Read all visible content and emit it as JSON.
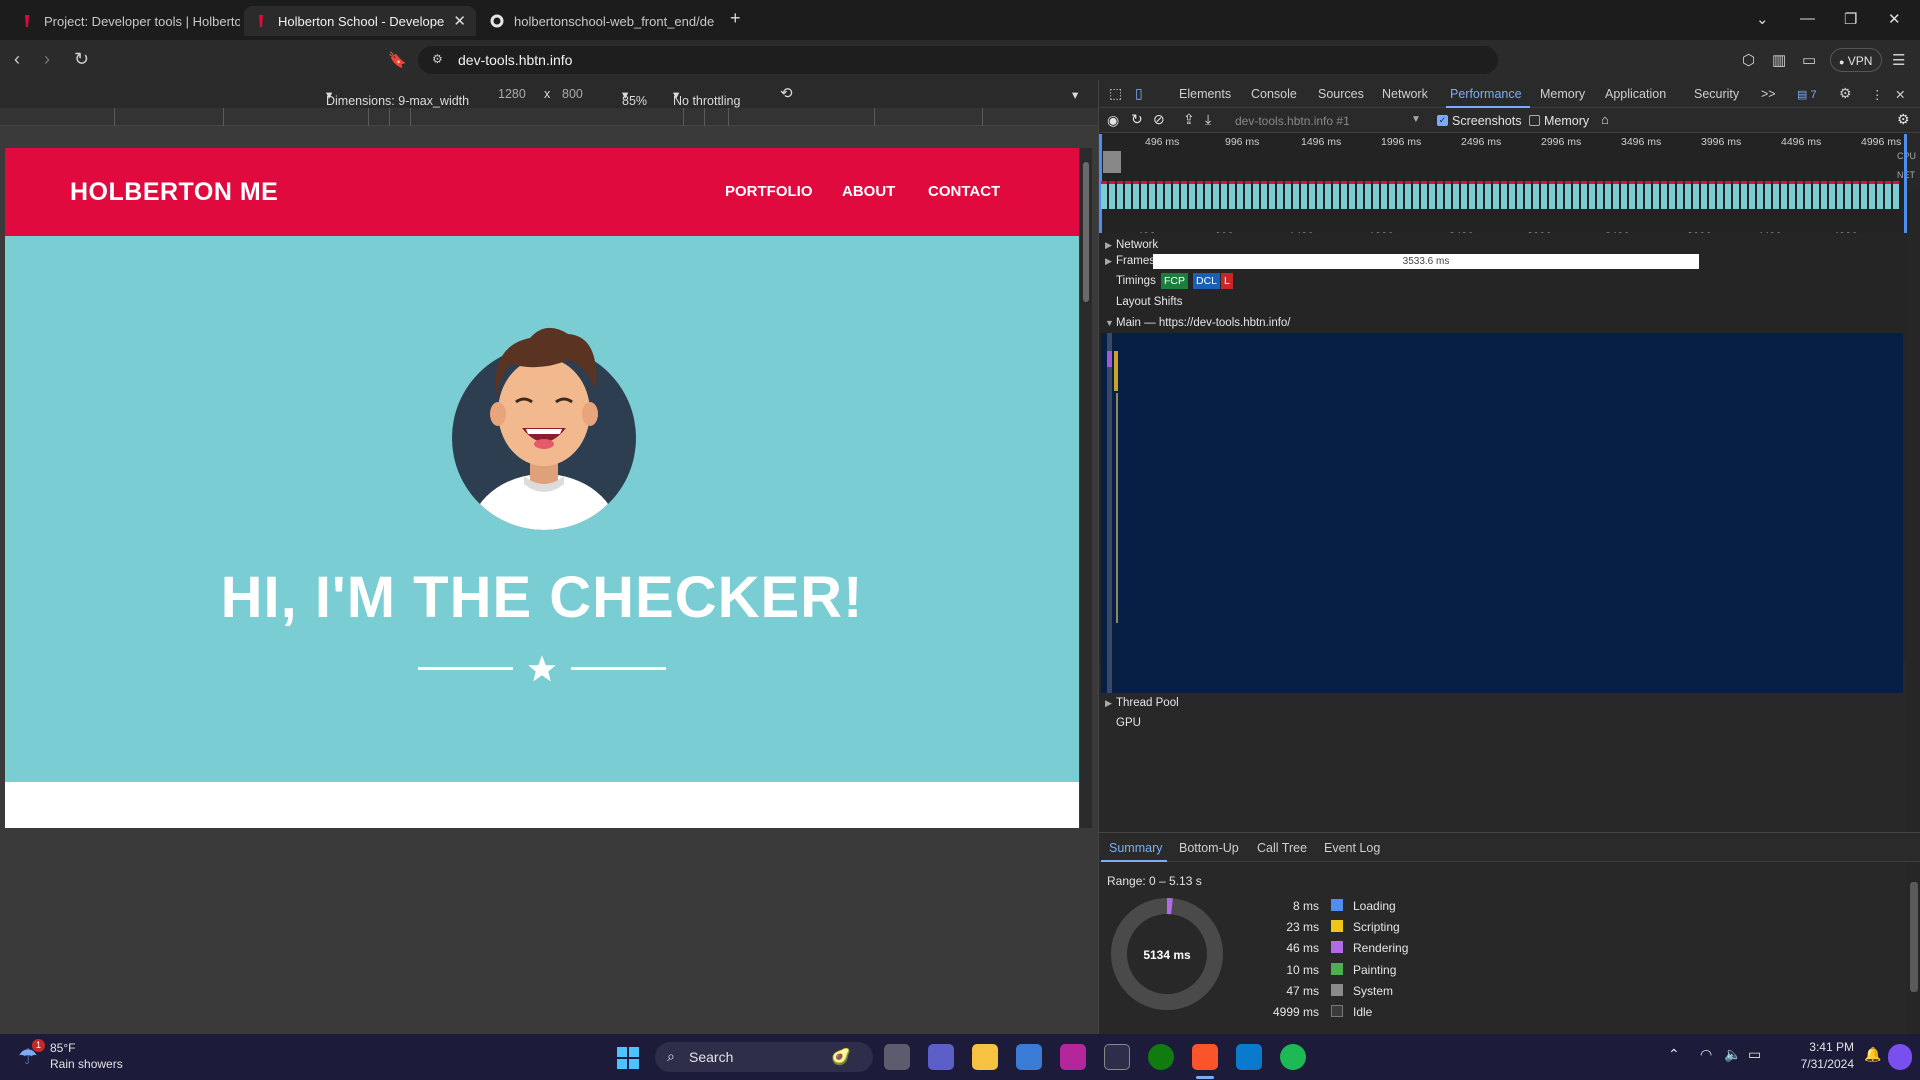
{
  "tabs": [
    {
      "title": "Project: Developer tools | Holberton"
    },
    {
      "title": "Holberton School - Developer t"
    },
    {
      "title": "holbertonschool-web_front_end/de"
    }
  ],
  "address": {
    "url": "dev-tools.hbtn.info"
  },
  "vpn_label": "VPN",
  "device_toolbar": {
    "dimensions": "Dimensions: 9-max_width",
    "width": "1280",
    "times": "x",
    "height": "800",
    "zoom": "85%",
    "throttle": "No throttling"
  },
  "site": {
    "brand": "HOLBERTON ME",
    "nav": [
      "PORTFOLIO",
      "ABOUT",
      "CONTACT"
    ],
    "hero_title": "HI, I'M THE CHECKER!"
  },
  "devtools": {
    "tabs": [
      "Elements",
      "Console",
      "Sources",
      "Network",
      "Performance",
      "Memory",
      "Application",
      "Security"
    ],
    "more": ">>",
    "issues_count": "7",
    "recording": "dev-tools.hbtn.info #1",
    "screenshots_label": "Screenshots",
    "memory_label": "Memory",
    "overview_ticks": [
      "496 ms",
      "996 ms",
      "1496 ms",
      "1996 ms",
      "2496 ms",
      "2996 ms",
      "3496 ms",
      "3996 ms",
      "4496 ms",
      "4996 ms"
    ],
    "cpu_label": "CPU",
    "net_label": "NET",
    "tracks": {
      "network": "Network",
      "frames": "Frames",
      "frame_duration": "3533.6 ms",
      "timings": "Timings",
      "fcp": "FCP",
      "dcl": "DCL",
      "l": "L",
      "layout_shifts": "Layout Shifts",
      "main": "Main — https://dev-tools.hbtn.info/",
      "thread_pool": "Thread Pool",
      "gpu": "GPU"
    },
    "summary_tabs": [
      "Summary",
      "Bottom-Up",
      "Call Tree",
      "Event Log"
    ],
    "range": "Range: 0 – 5.13 s",
    "total": "5134 ms",
    "legend": [
      {
        "ms": "8 ms",
        "label": "Loading",
        "color": "#4f8ef0"
      },
      {
        "ms": "23 ms",
        "label": "Scripting",
        "color": "#f0c419"
      },
      {
        "ms": "46 ms",
        "label": "Rendering",
        "color": "#b26be6"
      },
      {
        "ms": "10 ms",
        "label": "Painting",
        "color": "#4caf50"
      },
      {
        "ms": "47 ms",
        "label": "System",
        "color": "#8a8a8a"
      },
      {
        "ms": "4999 ms",
        "label": "Idle",
        "color": "#3a3a3a"
      }
    ]
  },
  "taskbar": {
    "weather_temp": "85°F",
    "weather_desc": "Rain showers",
    "weather_badge": "1",
    "search": "Search",
    "time": "3:41 PM",
    "date": "7/31/2024"
  }
}
